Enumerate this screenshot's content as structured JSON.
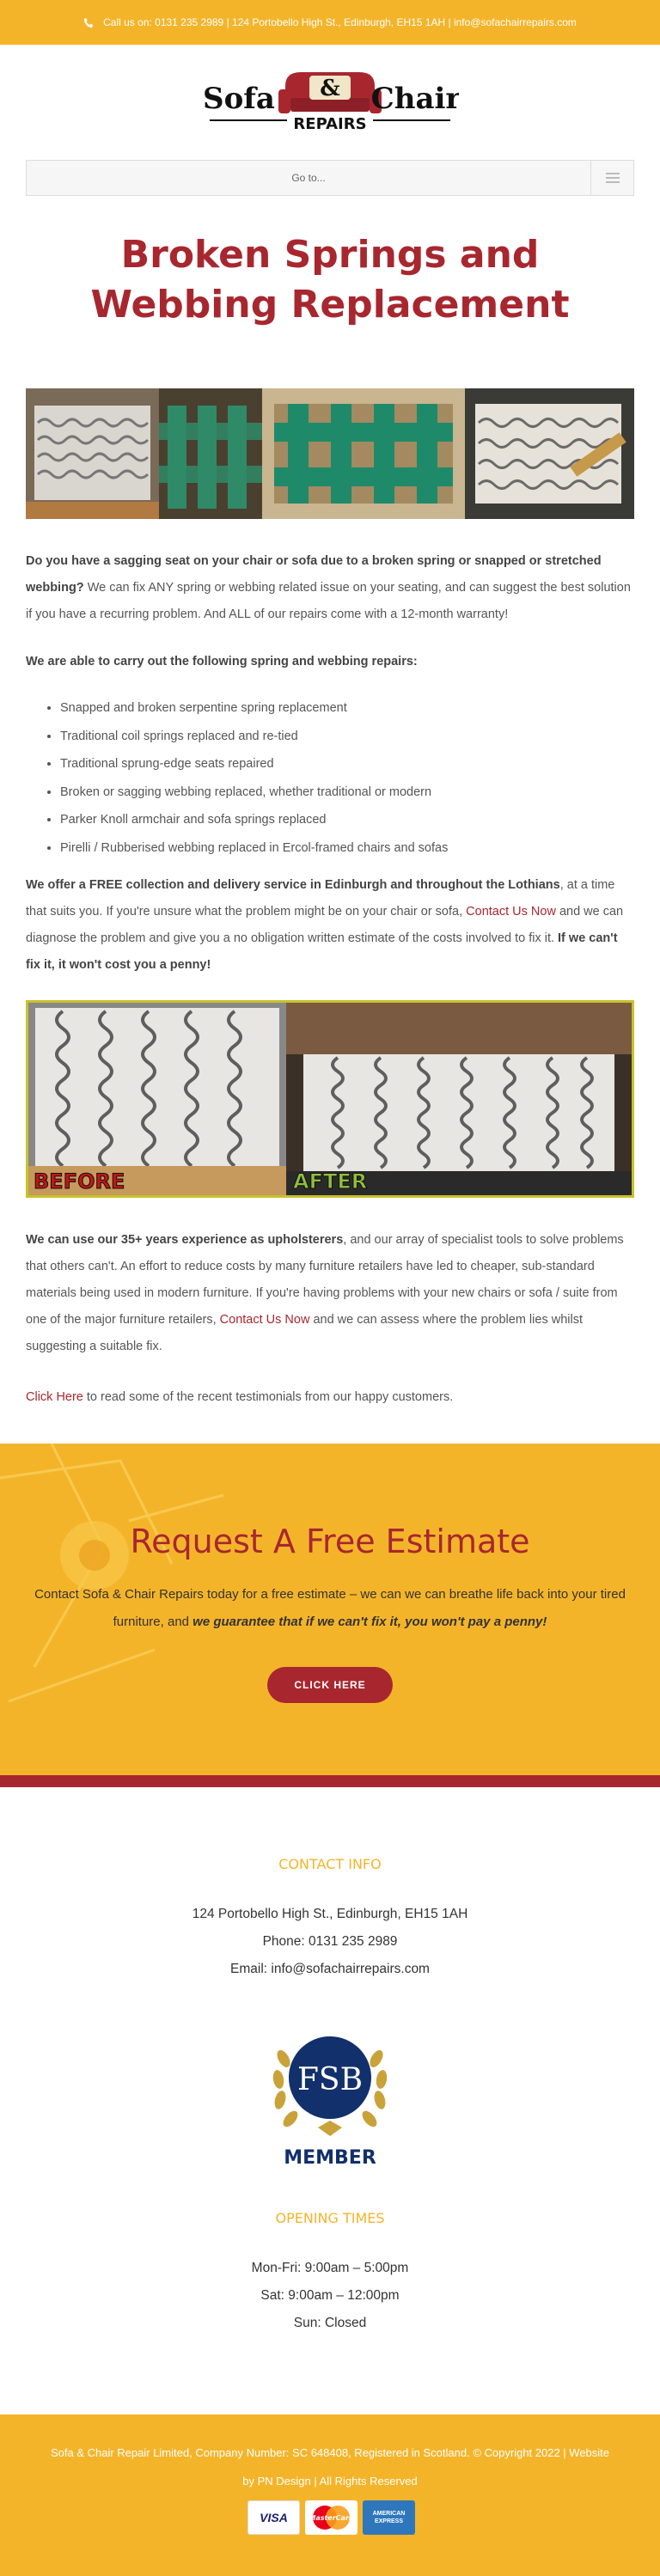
{
  "topbar": {
    "text": "Call us on: 0131 235 2989 | 124 Portobello High St., Edinburgh, EH15 1AH  |  info@sofachairrepairs.com"
  },
  "logo": {
    "word1": "Sofa",
    "ampersand": "&",
    "word2": "Chair",
    "sub": "REPAIRS"
  },
  "nav": {
    "label": "Go to..."
  },
  "page_title": "Broken Springs and Webbing Replacement",
  "intro": {
    "bold": "Do you have a sagging seat on your chair or sofa due to a broken spring or snapped or stretched webbing?",
    "text": " We can fix ANY spring or webbing related issue on your seating, and can suggest the best solution if you have a recurring problem. And ALL of our repairs come with a 12-month warranty!"
  },
  "repairs_heading": "We are able to carry out the following spring and webbing repairs:",
  "repairs": [
    "Snapped and broken serpentine spring replacement",
    "Traditional coil springs replaced and re-tied",
    "Traditional sprung-edge seats repaired",
    "Broken or sagging webbing replaced, whether traditional or modern",
    "Parker Knoll armchair and sofa springs replaced",
    "Pirelli / Rubberised webbing replaced in Ercol-framed chairs and sofas"
  ],
  "collection": {
    "bold": "We offer a FREE collection and delivery service in Edinburgh and throughout the Lothians",
    "text1": ", at a time that suits you. If you're unsure what the problem might be on your chair or sofa, ",
    "link": "Contact Us Now",
    "text2": " and we can diagnose the problem and give you a no obligation written estimate of the costs involved to fix it. ",
    "bold2": "If we can't fix it, it won't cost you a penny!"
  },
  "before_after": {
    "before": "BEFORE",
    "after": "AFTER"
  },
  "experience": {
    "bold": "We can use our 35+ years experience as upholsterers",
    "text1": ", and our array of specialist tools to solve problems that others can't. An effort to reduce costs by many furniture retailers have led to cheaper, sub-standard materials being used in modern furniture. If you're having problems with your new chairs or sofa / suite from one of the major furniture retailers, ",
    "link": "Contact Us Now",
    "text2": " and we can assess where the problem lies whilst suggesting a suitable fix."
  },
  "testimonials": {
    "link": "Click Here",
    "text": " to read some of the recent testimonials from our happy customers."
  },
  "estimate": {
    "title": "Request A Free Estimate",
    "text": "Contact Sofa & Chair Repairs today for a free estimate – we can we can breathe life back into your tired furniture, and ",
    "emph": "we guarantee that if we can't fix it, you won't pay a penny!",
    "button": "CLICK HERE"
  },
  "contact": {
    "heading": "CONTACT INFO",
    "address": "124 Portobello High St., Edinburgh, EH15 1AH",
    "phone": "Phone: 0131 235 2989",
    "email": "Email: info@sofachairrepairs.com"
  },
  "fsb": {
    "letters": "FSB",
    "member": "MEMBER"
  },
  "opening": {
    "heading": "OPENING TIMES",
    "lines": [
      "Mon-Fri: 9:00am – 5:00pm",
      "Sat: 9:00am – 12:00pm",
      "Sun: Closed"
    ]
  },
  "footer": {
    "line1": "Sofa & Chair Repair Limited, Company Number: SC 648408, Registered in Scotland. © Copyright 2022  |  Website",
    "line2": "by PN Design  |  All Rights Reserved"
  },
  "cards": {
    "visa": "VISA",
    "mastercard": "MasterCard",
    "amex": "AMERICAN EXPRESS"
  },
  "colors": {
    "brand_red": "#a8272f",
    "brand_yellow": "#f4b42a",
    "frame_green": "#c8c229"
  }
}
